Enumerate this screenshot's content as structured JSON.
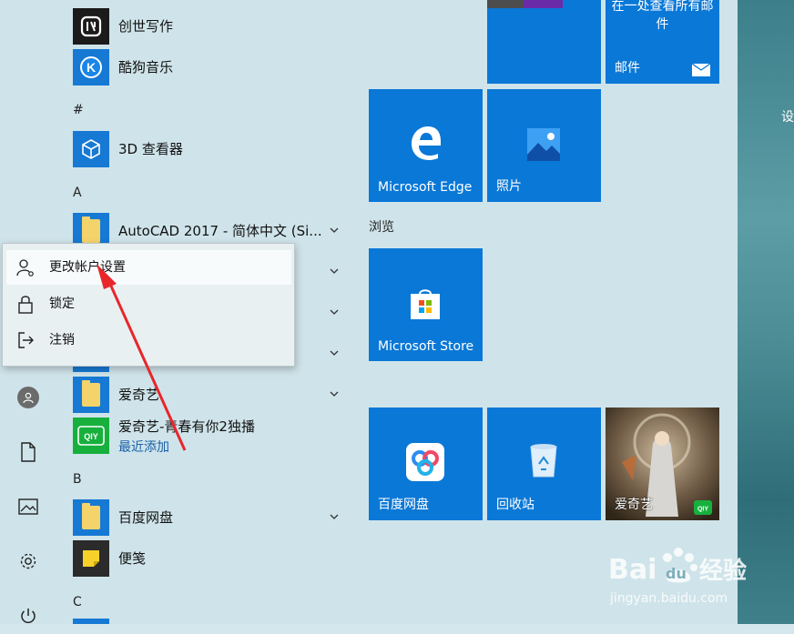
{
  "desktop": {
    "peek_text": "设"
  },
  "apps": [
    {
      "label": "创世写作"
    },
    {
      "label": "酷狗音乐"
    },
    {
      "label": "3D 查看器"
    },
    {
      "label": "AutoCAD 2017 - 简体中文 (Si..."
    },
    {
      "label": "爱奇艺"
    },
    {
      "label": "爱奇艺-青春有你2独播",
      "sub": "最近添加"
    },
    {
      "label": "百度网盘"
    },
    {
      "label": "便笺"
    }
  ],
  "letters": [
    "#",
    "A",
    "B",
    "C"
  ],
  "tiles": {
    "mail_text": "在一处查看所有邮件",
    "mail_label": "邮件",
    "edge_label": "Microsoft Edge",
    "photos_label": "照片",
    "group_browse": "浏览",
    "store_label": "Microsoft Store",
    "baidu_label": "百度网盘",
    "recycle_label": "回收站",
    "iqiyi_label": "爱奇艺"
  },
  "context_menu": [
    {
      "label": "更改帐户设置",
      "icon": "user-settings-icon"
    },
    {
      "label": "锁定",
      "icon": "lock-icon"
    },
    {
      "label": "注销",
      "icon": "sign-out-icon"
    }
  ],
  "watermark": {
    "brand": "Bai",
    "brand2": "du",
    "jingyan": "经验",
    "url": "jingyan.baidu.com"
  },
  "colors": {
    "tile_blue": "#0a78d7",
    "accent_arrow": "#e8262a"
  }
}
